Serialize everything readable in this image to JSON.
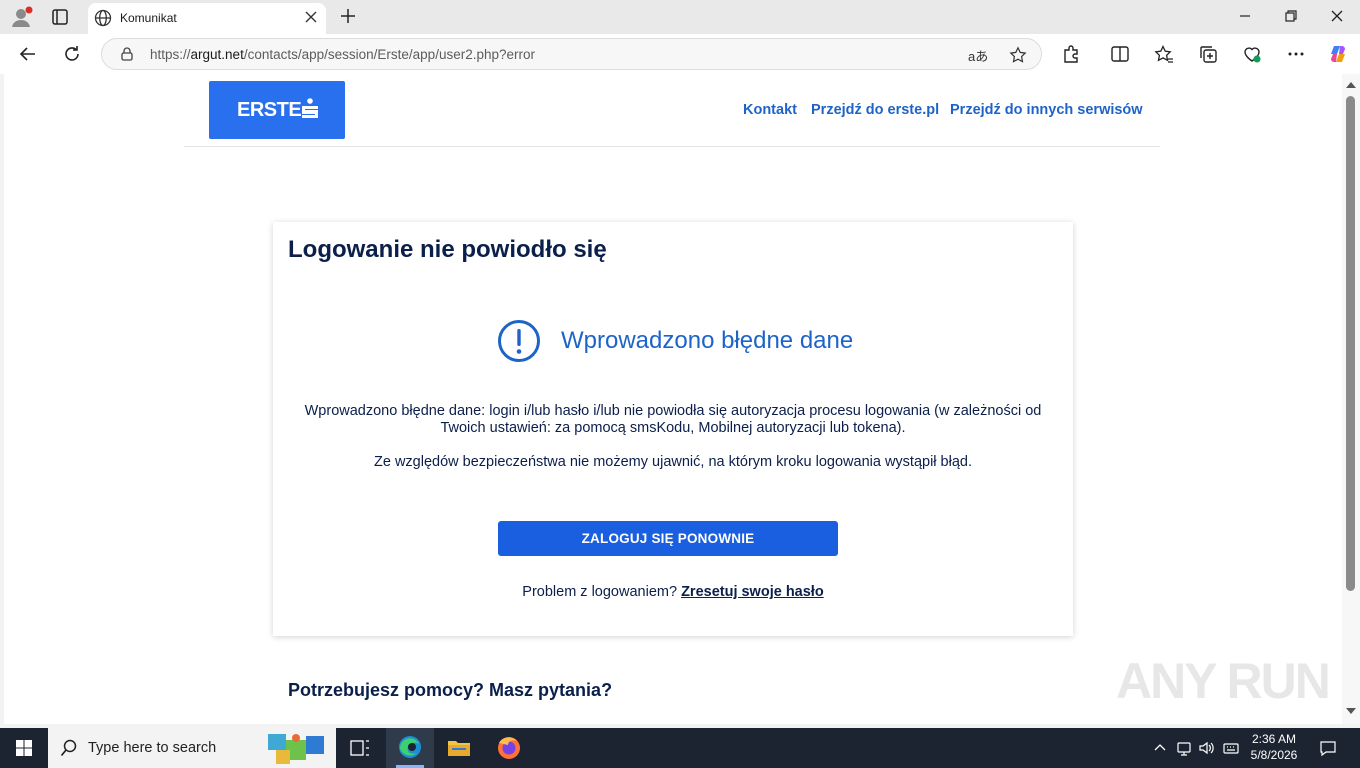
{
  "browser": {
    "tab_title": "Komunikat",
    "url_prefix": "https://",
    "url_host": "argut.net",
    "url_path": "/contacts/app/session/Erste/app/user2.php?error",
    "read_aloud_label": "aあ"
  },
  "page": {
    "logo_text": "ERSTE",
    "nav": {
      "contact": "Kontakt",
      "go_erste": "Przejdź do erste.pl",
      "go_other": "Przejdź do innych serwisów"
    },
    "card": {
      "heading": "Logowanie nie powiodło się",
      "alert_title": "Wprowadzono błędne dane",
      "message1": "Wprowadzono błędne dane: login i/lub hasło i/lub nie powiodła się autoryzacja procesu logowania (w zależności od Twoich ustawień: za pomocą smsKodu, Mobilnej autoryzacji lub tokena).",
      "message2": "Ze względów bezpieczeństwa nie możemy ujawnić, na którym kroku logowania wystąpił błąd.",
      "button": "ZALOGUJ SIĘ PONOWNIE",
      "problem_text": "Problem z logowaniem? ",
      "reset_link": "Zresetuj swoje hasło"
    },
    "help_heading": "Potrzebujesz pomocy? Masz pytania?",
    "watermark": "ANY RUN"
  },
  "taskbar": {
    "search_placeholder": "Type here to search",
    "time": "2:36 AM",
    "date": "5/8/2026"
  },
  "colors": {
    "brand_blue": "#2870ed",
    "button_blue": "#1a5fe0",
    "link_blue": "#1e64c8",
    "text_navy": "#0b1f4b"
  }
}
